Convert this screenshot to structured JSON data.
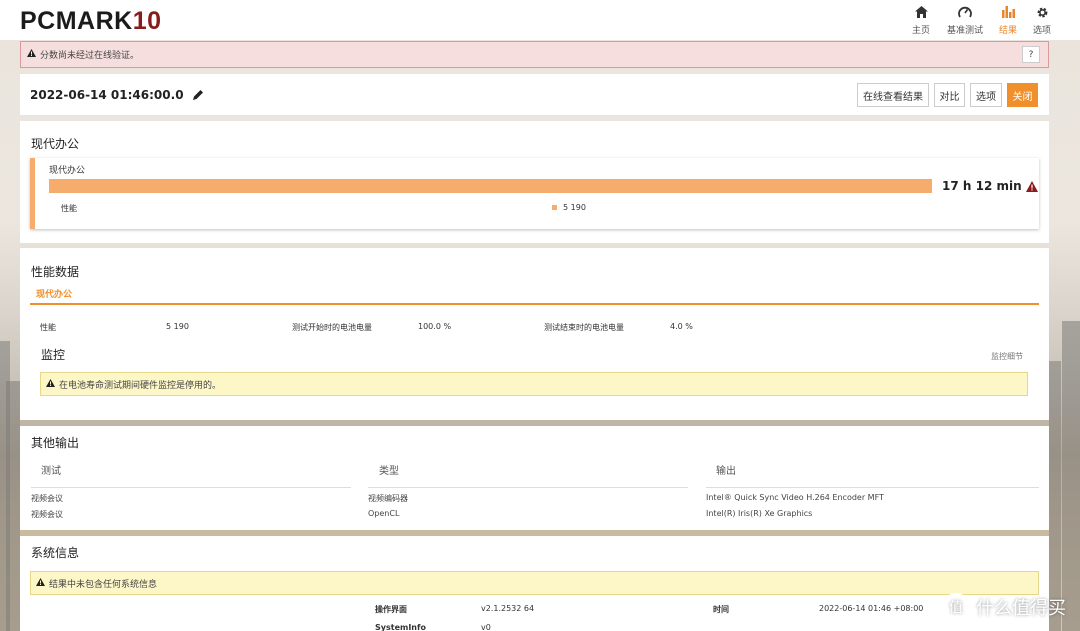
{
  "app": {
    "logo": "PCMARK",
    "logo_version": "10"
  },
  "nav": [
    {
      "label": "主页",
      "icon": "home-icon"
    },
    {
      "label": "基准测试",
      "icon": "gauge-icon"
    },
    {
      "label": "结果",
      "icon": "bar-chart-icon",
      "active": true
    },
    {
      "label": "选项",
      "icon": "gear-icon"
    }
  ],
  "warning": {
    "text": "分数尚未经过在线验证。",
    "help": "?"
  },
  "result": {
    "datetime": "2022-06-14 01:46:00.0",
    "buttons": {
      "view_online": "在线查看结果",
      "compare": "对比",
      "options": "选项",
      "close": "关闭"
    }
  },
  "summary": {
    "section_title": "现代办公",
    "card_title": "现代办公",
    "score": "17 h 12 min",
    "perf_label": "性能",
    "perf_value": "5 190"
  },
  "perf_data": {
    "title": "性能数据",
    "tab": "现代办公",
    "row": [
      {
        "label": "性能",
        "value": "5 190"
      },
      {
        "label": "测试开始时的电池电量",
        "value": "100.0 %"
      },
      {
        "label": "测试结束时的电池电量",
        "value": "4.0 %"
      }
    ],
    "monitor_title": "监控",
    "monitor_link": "监控细节",
    "monitor_note": "在电池寿命测试期间硬件监控是停用的。"
  },
  "other_output": {
    "title": "其他输出",
    "headers": [
      "测试",
      "类型",
      "输出"
    ],
    "rows": [
      [
        "视频会议",
        "视频编码器",
        "Intel® Quick Sync Video H.264 Encoder MFT"
      ],
      [
        "视频会议",
        "OpenCL",
        "Intel(R) Iris(R) Xe Graphics"
      ]
    ]
  },
  "system_info": {
    "title": "系统信息",
    "note": "结果中未包含任何系统信息",
    "rows": [
      {
        "label": "操作界面",
        "value": "v2.1.2532 64",
        "label2": "时间",
        "value2": "2022-06-14 01:46 +08:00"
      },
      {
        "label": "SystemInfo",
        "value": "v0"
      }
    ]
  },
  "watermark": {
    "icon_text": "值",
    "text": "什么值得买"
  },
  "colors": {
    "accent": "#f0902d",
    "bar": "#f6ac6d",
    "warn_bg": "#f6dede",
    "note_bg": "#fdf7c8",
    "alert_red": "#8a1b1b"
  }
}
